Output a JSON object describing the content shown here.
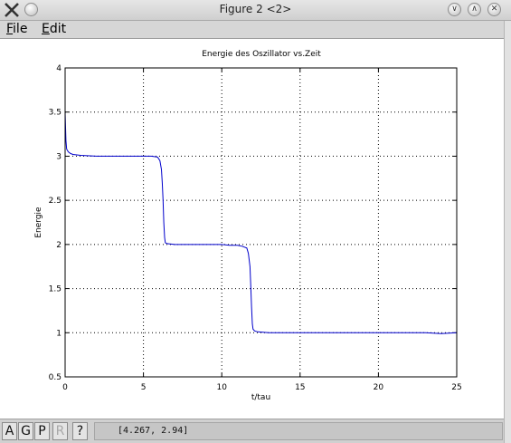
{
  "window": {
    "title": "Figure 2 <2>",
    "app_icon": "x-logo-icon",
    "pin_icon": "pin-icon",
    "controls": [
      {
        "name": "minimize",
        "glyph": "∨"
      },
      {
        "name": "maximize",
        "glyph": "∧"
      },
      {
        "name": "close",
        "glyph": "✕"
      }
    ]
  },
  "menu": {
    "file": {
      "mnemonic": "F",
      "rest": "ile"
    },
    "edit": {
      "mnemonic": "E",
      "rest": "dit"
    }
  },
  "toolbar": {
    "buttons": [
      {
        "label": "A",
        "enabled": true
      },
      {
        "label": "G",
        "enabled": true
      },
      {
        "label": "P",
        "enabled": true
      },
      {
        "label": "R",
        "enabled": false
      },
      {
        "label": "?",
        "enabled": true
      }
    ]
  },
  "status": {
    "coords": "[4.267,  2.94]"
  },
  "colors": {
    "line": "#0000cc",
    "grid": "#000000",
    "window_bg": "#d6d6d6"
  },
  "chart_data": {
    "type": "line",
    "title": "Energie des Oszillator vs.Zeit",
    "xlabel": "t/tau",
    "ylabel": "Energie",
    "xlim": [
      0,
      25
    ],
    "ylim": [
      0.5,
      4
    ],
    "xticks": [
      0,
      5,
      10,
      15,
      20,
      25
    ],
    "yticks": [
      0.5,
      1,
      1.5,
      2,
      2.5,
      3,
      3.5,
      4
    ],
    "ytick_labels": [
      "0.5",
      "1",
      "1.5",
      "2",
      "2.5",
      "3",
      "3.5",
      "4"
    ],
    "grid": true,
    "series": [
      {
        "x": [
          0,
          0.05,
          0.1,
          0.2,
          0.35,
          0.5,
          1,
          2,
          3,
          4,
          5,
          5.5,
          5.9,
          6.05,
          6.15,
          6.2,
          6.25,
          6.3,
          6.35,
          6.4,
          6.5,
          7,
          8,
          9,
          10,
          10.5,
          11,
          11.3,
          11.6,
          11.7,
          11.8,
          11.85,
          11.9,
          11.95,
          12.0,
          12.1,
          12.3,
          13,
          14,
          15,
          16,
          17,
          18,
          19,
          20,
          21,
          22,
          23,
          24,
          25
        ],
        "y": [
          3.5,
          3.18,
          3.08,
          3.05,
          3.03,
          3.02,
          3.01,
          3.0,
          3.0,
          3.0,
          3.0,
          3.0,
          2.99,
          2.95,
          2.85,
          2.7,
          2.5,
          2.25,
          2.08,
          2.02,
          2.01,
          2.0,
          2.0,
          2.0,
          2.0,
          1.99,
          1.99,
          1.98,
          1.96,
          1.9,
          1.75,
          1.55,
          1.3,
          1.1,
          1.04,
          1.02,
          1.01,
          1.0,
          1.0,
          1.0,
          1.0,
          1.0,
          1.0,
          1.0,
          1.0,
          1.0,
          1.0,
          1.0,
          0.99,
          1.0
        ]
      }
    ]
  }
}
